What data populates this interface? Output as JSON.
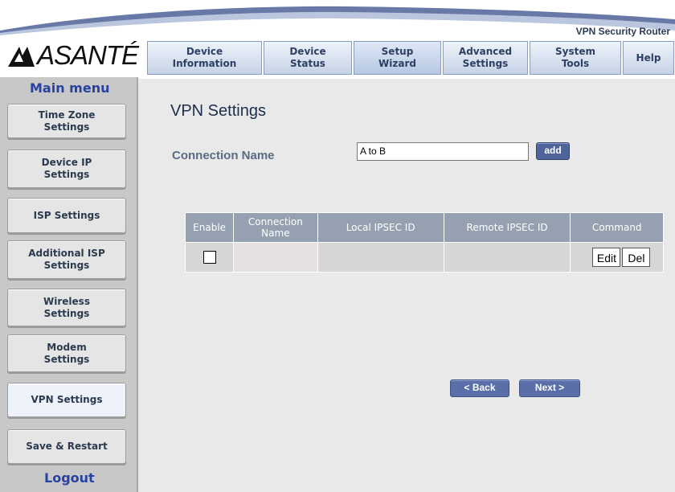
{
  "brand": {
    "logo_text": "ASANTÉ",
    "product_name": "VPN Security Router"
  },
  "top_nav": {
    "tabs": [
      {
        "label": "Device\nInformation"
      },
      {
        "label": "Device\nStatus"
      },
      {
        "label": "Setup\nWizard"
      },
      {
        "label": "Advanced\nSettings"
      },
      {
        "label": "System\nTools"
      },
      {
        "label": "Help"
      }
    ]
  },
  "sidebar": {
    "title": "Main menu",
    "items": [
      {
        "label": "Time Zone\nSettings"
      },
      {
        "label": "Device IP\nSettings"
      },
      {
        "label": "ISP Settings"
      },
      {
        "label": "Additional ISP\nSettings"
      },
      {
        "label": "Wireless\nSettings"
      },
      {
        "label": "Modem\nSettings"
      },
      {
        "label": "VPN Settings"
      },
      {
        "label": "Save & Restart"
      }
    ],
    "logout_label": "Logout"
  },
  "main": {
    "title": "VPN Settings",
    "connection_name_label": "Connection Name",
    "connection_name_value": "A to B",
    "add_label": "add",
    "table": {
      "headers": [
        "Enable",
        "Connection Name",
        "Local IPSEC ID",
        "Remote IPSEC ID",
        "Command"
      ],
      "commands": {
        "edit": "Edit",
        "delete": "Del"
      }
    },
    "back_label": "< Back",
    "next_label": "Next >"
  },
  "colors": {
    "nav_text": "#2d3f64",
    "sidebar_bg": "#c8c8c8",
    "content_bg": "#e9e9e9",
    "table_header": "#95a0b1",
    "button_blue": "#5a6ea7"
  }
}
